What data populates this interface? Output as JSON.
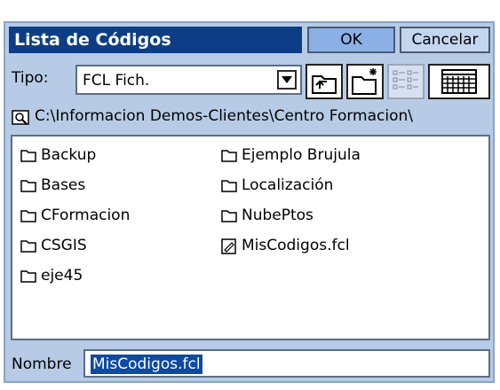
{
  "dialog": {
    "title": "Lista de Códigos",
    "ok_label": "OK",
    "cancel_label": "Cancelar"
  },
  "tipo": {
    "label": "Tipo:",
    "selected": "FCL Fich."
  },
  "toolbar": {
    "icons": [
      "up-folder-icon",
      "new-folder-icon",
      "list-view-icon",
      "details-view-icon"
    ]
  },
  "path": {
    "value": "C:\\Informacion Demos-Clientes\\Centro Formacion\\"
  },
  "files": [
    {
      "name": "Backup",
      "kind": "folder"
    },
    {
      "name": "Bases",
      "kind": "folder"
    },
    {
      "name": "CFormacion",
      "kind": "folder"
    },
    {
      "name": "CSGIS",
      "kind": "folder"
    },
    {
      "name": "eje45",
      "kind": "folder"
    },
    {
      "name": "Ejemplo Brujula",
      "kind": "folder"
    },
    {
      "name": "Localización",
      "kind": "folder"
    },
    {
      "name": "NubePtos",
      "kind": "folder"
    },
    {
      "name": "MisCodigos.fcl",
      "kind": "file"
    }
  ],
  "nombre": {
    "label": "Nombre",
    "value": "MisCodigos.fcl"
  }
}
